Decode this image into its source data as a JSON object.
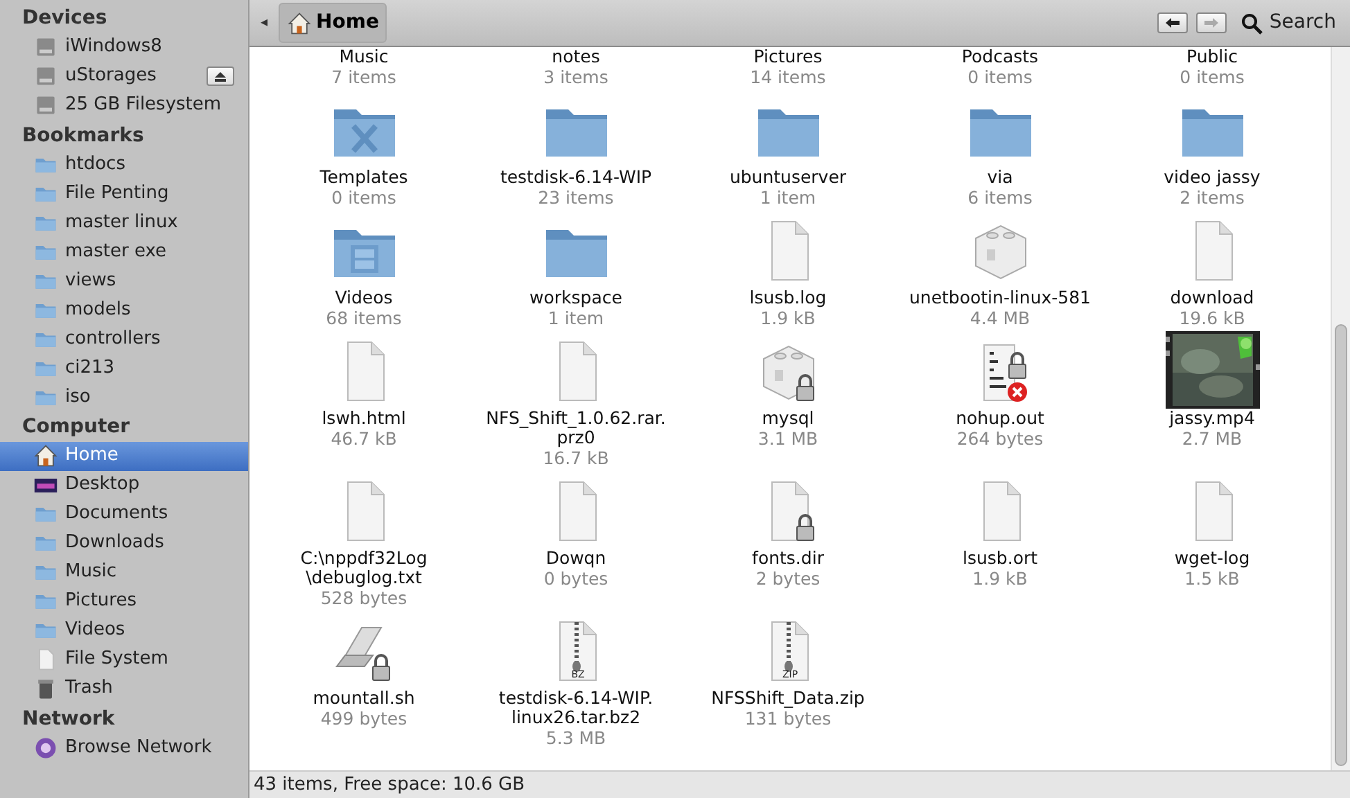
{
  "sidebar": {
    "sections": [
      {
        "title": "Devices",
        "items": [
          {
            "label": "iWindows8",
            "kind": "drive",
            "selected": false,
            "eject": false
          },
          {
            "label": "uStorages",
            "kind": "drive",
            "selected": false,
            "eject": true
          },
          {
            "label": "25 GB Filesystem",
            "kind": "drive",
            "selected": false,
            "eject": false
          }
        ]
      },
      {
        "title": "Bookmarks",
        "items": [
          {
            "label": "htdocs",
            "kind": "folder",
            "selected": false,
            "eject": false
          },
          {
            "label": "File Penting",
            "kind": "folder",
            "selected": false,
            "eject": false
          },
          {
            "label": "master linux",
            "kind": "folder",
            "selected": false,
            "eject": false
          },
          {
            "label": "master exe",
            "kind": "folder",
            "selected": false,
            "eject": false
          },
          {
            "label": "views",
            "kind": "folder",
            "selected": false,
            "eject": false
          },
          {
            "label": "models",
            "kind": "folder",
            "selected": false,
            "eject": false
          },
          {
            "label": "controllers",
            "kind": "folder",
            "selected": false,
            "eject": false
          },
          {
            "label": "ci213",
            "kind": "folder",
            "selected": false,
            "eject": false
          },
          {
            "label": "iso",
            "kind": "folder",
            "selected": false,
            "eject": false
          }
        ]
      },
      {
        "title": "Computer",
        "items": [
          {
            "label": "Home",
            "kind": "home",
            "selected": true,
            "eject": false
          },
          {
            "label": "Desktop",
            "kind": "desktop",
            "selected": false,
            "eject": false
          },
          {
            "label": "Documents",
            "kind": "folder",
            "selected": false,
            "eject": false
          },
          {
            "label": "Downloads",
            "kind": "folder",
            "selected": false,
            "eject": false
          },
          {
            "label": "Music",
            "kind": "folder",
            "selected": false,
            "eject": false
          },
          {
            "label": "Pictures",
            "kind": "folder",
            "selected": false,
            "eject": false
          },
          {
            "label": "Videos",
            "kind": "folder",
            "selected": false,
            "eject": false
          },
          {
            "label": "File System",
            "kind": "file",
            "selected": false,
            "eject": false
          },
          {
            "label": "Trash",
            "kind": "trash",
            "selected": false,
            "eject": false
          }
        ]
      },
      {
        "title": "Network",
        "items": [
          {
            "label": "Browse Network",
            "kind": "network",
            "selected": false,
            "eject": false
          }
        ]
      }
    ]
  },
  "toolbar": {
    "path_toggle": "◂",
    "breadcrumbs": [
      {
        "label": "Home",
        "selected": true
      }
    ],
    "back_disabled": false,
    "forward_disabled": true,
    "search": "Search"
  },
  "files": [
    {
      "name": "Music",
      "info": "7 items",
      "kind": "hidden"
    },
    {
      "name": "notes",
      "info": "3 items",
      "kind": "hidden"
    },
    {
      "name": "Pictures",
      "info": "14 items",
      "kind": "hidden"
    },
    {
      "name": "Podcasts",
      "info": "0 items",
      "kind": "hidden"
    },
    {
      "name": "Public",
      "info": "0 items",
      "kind": "hidden"
    },
    {
      "name": "Templates",
      "info": "0 items",
      "kind": "folder-x"
    },
    {
      "name": "testdisk-6.14-WIP",
      "info": "23 items",
      "kind": "folder"
    },
    {
      "name": "ubuntuserver",
      "info": "1 item",
      "kind": "folder"
    },
    {
      "name": "via",
      "info": "6 items",
      "kind": "folder"
    },
    {
      "name": "video jassy",
      "info": "2 items",
      "kind": "folder"
    },
    {
      "name": "Videos",
      "info": "68 items",
      "kind": "folder-film"
    },
    {
      "name": "workspace",
      "info": "1 item",
      "kind": "folder"
    },
    {
      "name": "lsusb.log",
      "info": "1.9 kB",
      "kind": "file"
    },
    {
      "name": "unetbootin-linux-581",
      "info": "4.4 MB",
      "kind": "package"
    },
    {
      "name": "download",
      "info": "19.6 kB",
      "kind": "file"
    },
    {
      "name": "lswh.html",
      "info": "46.7 kB",
      "kind": "file"
    },
    {
      "name": "NFS_Shift_1.0.62.rar.prz0",
      "info": "16.7 kB",
      "kind": "file"
    },
    {
      "name": "mysql",
      "info": "3.1 MB",
      "kind": "package-locked"
    },
    {
      "name": "nohup.out",
      "info": "264 bytes",
      "kind": "binary-error"
    },
    {
      "name": "jassy.mp4",
      "info": "2.7 MB",
      "kind": "video"
    },
    {
      "name": "C:\\nppdf32Log\\debuglog.txt",
      "info": "528 bytes",
      "kind": "file"
    },
    {
      "name": "Dowqn",
      "info": "0 bytes",
      "kind": "file"
    },
    {
      "name": "fonts.dir",
      "info": "2 bytes",
      "kind": "file-locked"
    },
    {
      "name": "lsusb.ort",
      "info": "1.9 kB",
      "kind": "file"
    },
    {
      "name": "wget-log",
      "info": "1.5 kB",
      "kind": "file"
    },
    {
      "name": "mountall.sh",
      "info": "499 bytes",
      "kind": "script-locked"
    },
    {
      "name": "testdisk-6.14-WIP.linux26.tar.bz2",
      "info": "5.3 MB",
      "kind": "archive",
      "badge": "BZ"
    },
    {
      "name": "NFSShift_Data.zip",
      "info": "131 bytes",
      "kind": "archive",
      "badge": "ZIP"
    }
  ],
  "status_bar": "43 items, Free space: 10.6 GB"
}
